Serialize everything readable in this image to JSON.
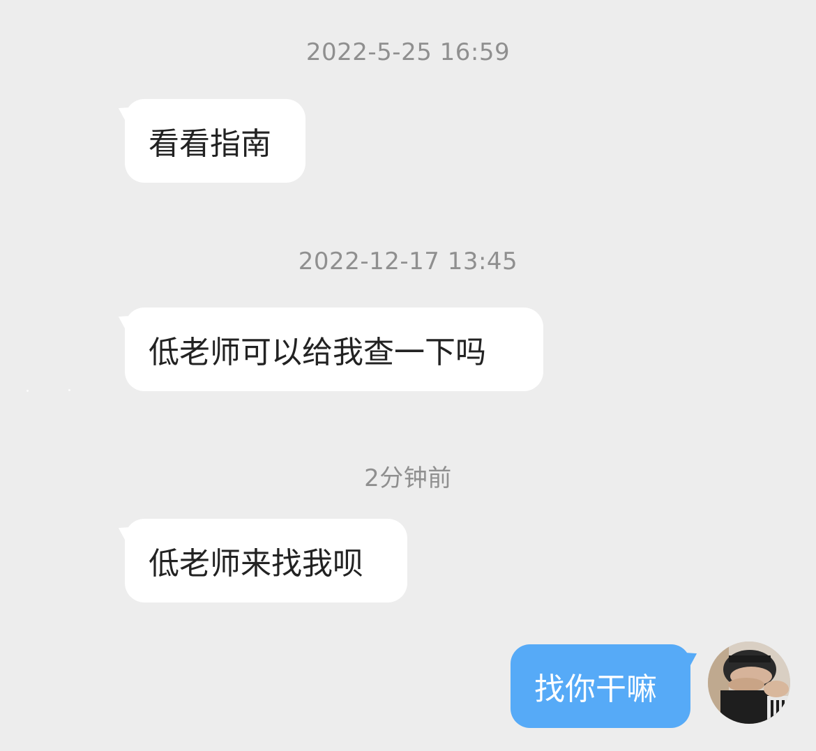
{
  "messages": [
    {
      "timestamp": "2022-5-25 16:59",
      "text": "看看指南",
      "direction": "incoming"
    },
    {
      "timestamp": "2022-12-17 13:45",
      "text": "低老师可以给我查一下吗",
      "direction": "incoming"
    },
    {
      "timestamp": "2分钟前",
      "text": "低老师来找我呗",
      "direction": "incoming"
    },
    {
      "text": "找你干嘛",
      "direction": "outgoing"
    }
  ],
  "colors": {
    "background": "#ededed",
    "incoming_bubble": "#ffffff",
    "outgoing_bubble": "#56aaf7",
    "timestamp_text": "#8f8f8f"
  },
  "icons": {
    "sender_avatar": "user-avatar-photo"
  }
}
